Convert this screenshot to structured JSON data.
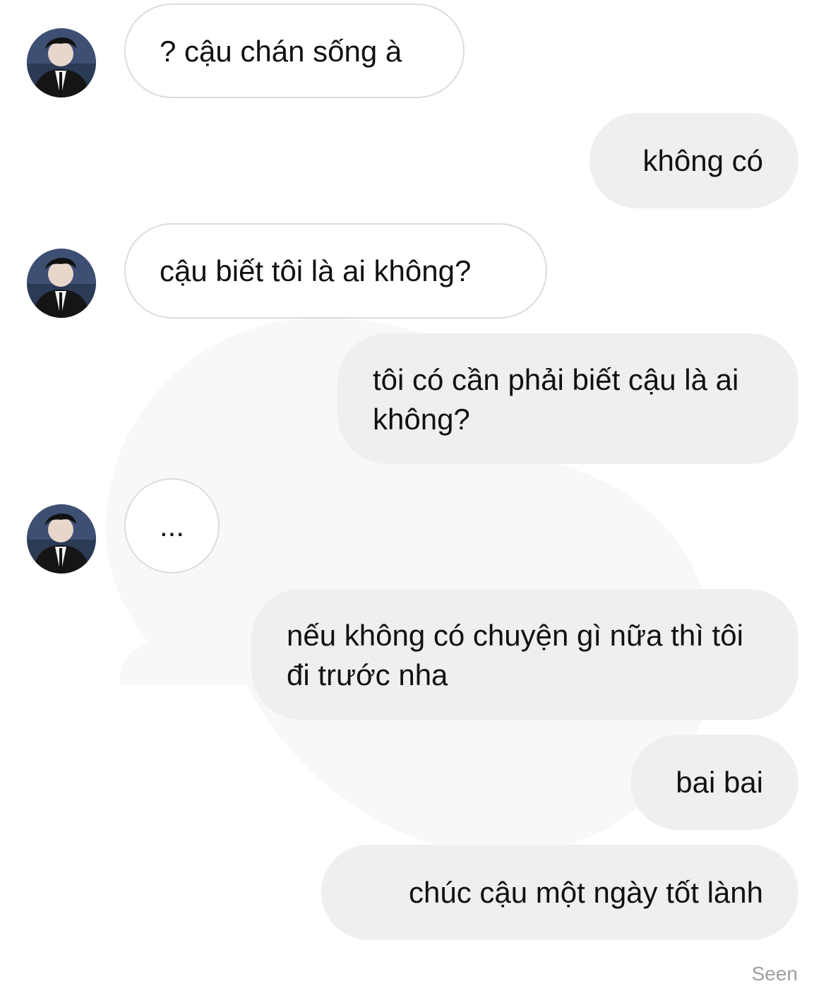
{
  "conversation": {
    "messages": [
      {
        "direction": "incoming",
        "text": "? cậu chán sống à"
      },
      {
        "direction": "outgoing",
        "text": "không có"
      },
      {
        "direction": "incoming",
        "text": "cậu biết tôi là ai không?"
      },
      {
        "direction": "outgoing",
        "text": "tôi có cần phải biết cậu là ai không?"
      },
      {
        "direction": "incoming",
        "text": "..."
      },
      {
        "direction": "outgoing",
        "text": "nếu không có chuyện gì nữa thì tôi đi trước nha"
      },
      {
        "direction": "outgoing",
        "text": "bai bai"
      },
      {
        "direction": "outgoing",
        "text": "chúc cậu một ngày tốt lành"
      }
    ],
    "status": "Seen"
  },
  "colors": {
    "incoming_bubble_border": "#dcdcdc",
    "outgoing_bubble_bg": "#efefef",
    "text": "#111111",
    "status_text": "#a0a0a0"
  }
}
